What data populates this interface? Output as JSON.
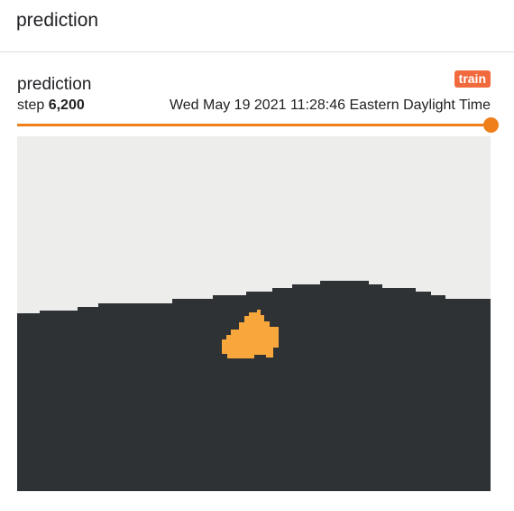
{
  "page": {
    "title": "prediction"
  },
  "card": {
    "title": "prediction",
    "run_badge": "train",
    "step_label": "step",
    "step_value": "6,200",
    "timestamp": "Wed May 19 2021 11:28:46 Eastern Daylight Time",
    "step_slider_progress": 1.0
  },
  "image": {
    "description_kind": "segmentation-prediction",
    "colors": {
      "sky": "#ededeb",
      "ground": "#2e3235",
      "object": "#f7a73b"
    }
  },
  "colors": {
    "accent": "#ef7f1a",
    "badge": "#f06a3d"
  }
}
